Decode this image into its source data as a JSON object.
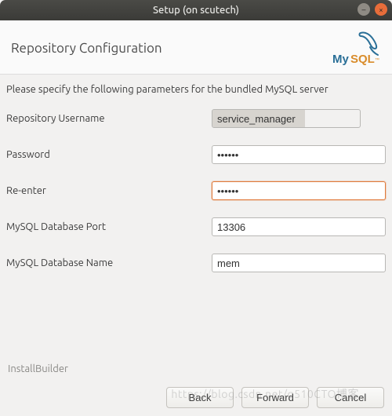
{
  "window": {
    "title": "Setup (on scutech)"
  },
  "header": {
    "title": "Repository Configuration",
    "logo_text": "MySQL"
  },
  "intro": "Please specify the following parameters for the bundled MySQL server",
  "fields": {
    "username_label": "Repository Username",
    "username_value": "service_manager",
    "password_label": "Password",
    "password_value": "••••••",
    "reenter_label": "Re-enter",
    "reenter_value": "••••••",
    "port_label": "MySQL Database Port",
    "port_value": "13306",
    "dbname_label": "MySQL Database Name",
    "dbname_value": "mem"
  },
  "footer": {
    "brand": "InstallBuilder",
    "back": "Back",
    "forward": "Forward",
    "cancel": "Cancel"
  },
  "watermark": "https://blog.csdn.net/q510CTO博客",
  "colors": {
    "accent_orange": "#e07b3d"
  }
}
